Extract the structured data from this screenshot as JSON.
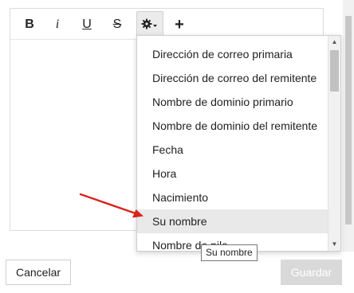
{
  "toolbar": {
    "bold_label": "B",
    "italic_label": "i",
    "underline_label": "U",
    "strikethrough_label": "S",
    "insert_label": "+"
  },
  "dropdown": {
    "items": [
      {
        "label": "Dirección de correo primaria"
      },
      {
        "label": "Dirección de correo del remitente"
      },
      {
        "label": "Nombre de dominio primario"
      },
      {
        "label": "Nombre de dominio del remitente"
      },
      {
        "label": "Fecha"
      },
      {
        "label": "Hora"
      },
      {
        "label": "Nacimiento"
      },
      {
        "label": "Su nombre",
        "active": true
      },
      {
        "label": "Nombre de pila"
      }
    ]
  },
  "tooltip": {
    "text": "Su nombre"
  },
  "footer": {
    "cancel_label": "Cancelar",
    "save_label": "Guardar"
  },
  "colors": {
    "arrow": "#d9231d",
    "active_item_bg": "#e9e9e9",
    "save_button_bg": "#d9d9d9"
  }
}
